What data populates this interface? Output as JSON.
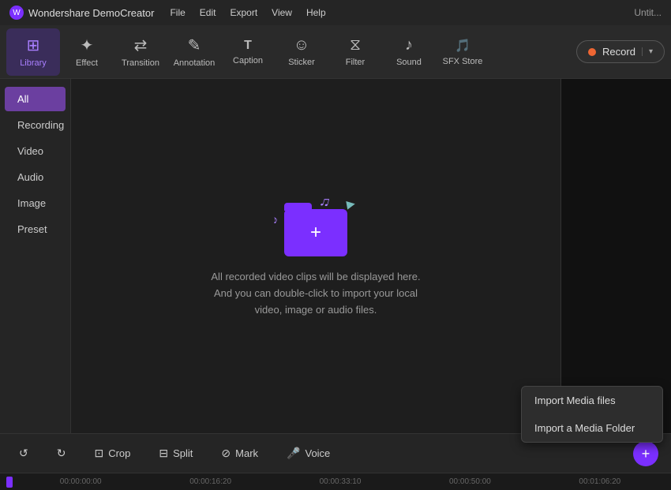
{
  "titlebar": {
    "logo_text": "W",
    "app_name": "Wondershare DemoCreator",
    "menu": [
      "File",
      "Edit",
      "Export",
      "View",
      "Help"
    ],
    "title": "Untit..."
  },
  "toolbar": {
    "tools": [
      {
        "id": "library",
        "label": "Library",
        "icon": "⊞",
        "active": true
      },
      {
        "id": "effect",
        "label": "Effect",
        "icon": "✦",
        "active": false
      },
      {
        "id": "transition",
        "label": "Transition",
        "icon": "⇄",
        "active": false
      },
      {
        "id": "annotation",
        "label": "Annotation",
        "icon": "✎",
        "active": false
      },
      {
        "id": "caption",
        "label": "Caption",
        "icon": "T",
        "active": false
      },
      {
        "id": "sticker",
        "label": "Sticker",
        "icon": "☺",
        "active": false
      },
      {
        "id": "filter",
        "label": "Filter",
        "icon": "⧖",
        "active": false
      },
      {
        "id": "sound",
        "label": "Sound",
        "icon": "♪",
        "active": false
      },
      {
        "id": "sfxstore",
        "label": "SFX Store",
        "icon": "🎵",
        "active": false
      }
    ],
    "record_label": "Record"
  },
  "sidebar": {
    "items": [
      {
        "id": "all",
        "label": "All",
        "active": true
      },
      {
        "id": "recording",
        "label": "Recording",
        "active": false
      },
      {
        "id": "video",
        "label": "Video",
        "active": false
      },
      {
        "id": "audio",
        "label": "Audio",
        "active": false
      },
      {
        "id": "image",
        "label": "Image",
        "active": false
      },
      {
        "id": "preset",
        "label": "Preset",
        "active": false
      }
    ]
  },
  "empty_state": {
    "text": "All recorded video clips will be displayed here. And you can double-click to import your local video, image or audio files."
  },
  "bottom_toolbar": {
    "items": [
      {
        "id": "undo",
        "label": "",
        "icon": "↺"
      },
      {
        "id": "redo",
        "label": "",
        "icon": "↻"
      },
      {
        "id": "crop",
        "label": "Crop",
        "icon": "⊡"
      },
      {
        "id": "split",
        "label": "Split",
        "icon": "⊟"
      },
      {
        "id": "mark",
        "label": "Mark",
        "icon": "⊘"
      },
      {
        "id": "voice",
        "label": "Voice",
        "icon": "🎤"
      }
    ],
    "add_icon": "+"
  },
  "dropdown": {
    "items": [
      {
        "id": "import-media",
        "label": "Import Media files"
      },
      {
        "id": "import-folder",
        "label": "Import a Media Folder"
      }
    ]
  },
  "timeline": {
    "markers": [
      "00:00:00:00",
      "00:00:16:20",
      "00:00:33:10",
      "00:00:50:00",
      "00:01:06:20"
    ]
  }
}
